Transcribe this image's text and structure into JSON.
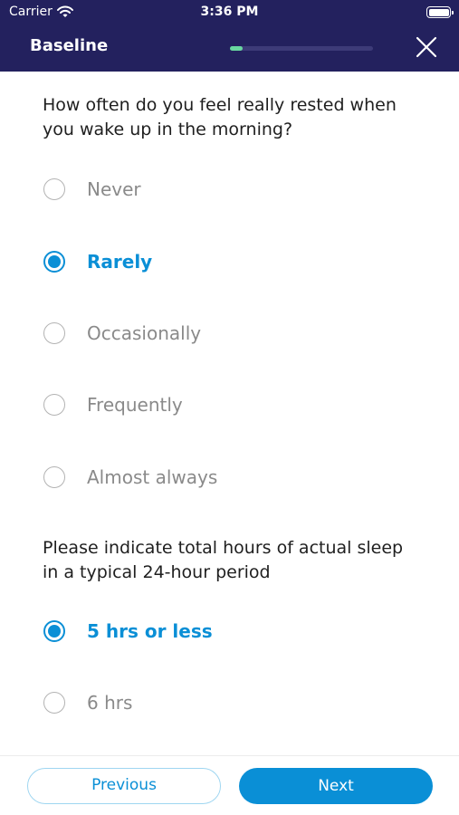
{
  "status_bar": {
    "carrier": "Carrier",
    "time": "3:36 PM"
  },
  "header": {
    "title": "Baseline",
    "progress_fraction": 0.09,
    "progress_color": "#69d8a0",
    "background_color": "#23215e"
  },
  "questions": [
    {
      "text": "How often do you feel really rested when you wake up in the morning?",
      "options": [
        {
          "label": "Never",
          "selected": false
        },
        {
          "label": "Rarely",
          "selected": true
        },
        {
          "label": "Occasionally",
          "selected": false
        },
        {
          "label": "Frequently",
          "selected": false
        },
        {
          "label": "Almost always",
          "selected": false
        }
      ]
    },
    {
      "text": "Please indicate total hours of actual sleep in a typical 24-hour period",
      "options": [
        {
          "label": "5 hrs or less",
          "selected": true
        },
        {
          "label": "6 hrs",
          "selected": false
        }
      ]
    }
  ],
  "footer": {
    "previous_label": "Previous",
    "next_label": "Next"
  },
  "colors": {
    "accent": "#0a8fd6",
    "unselected_text": "#8a8a8a"
  }
}
